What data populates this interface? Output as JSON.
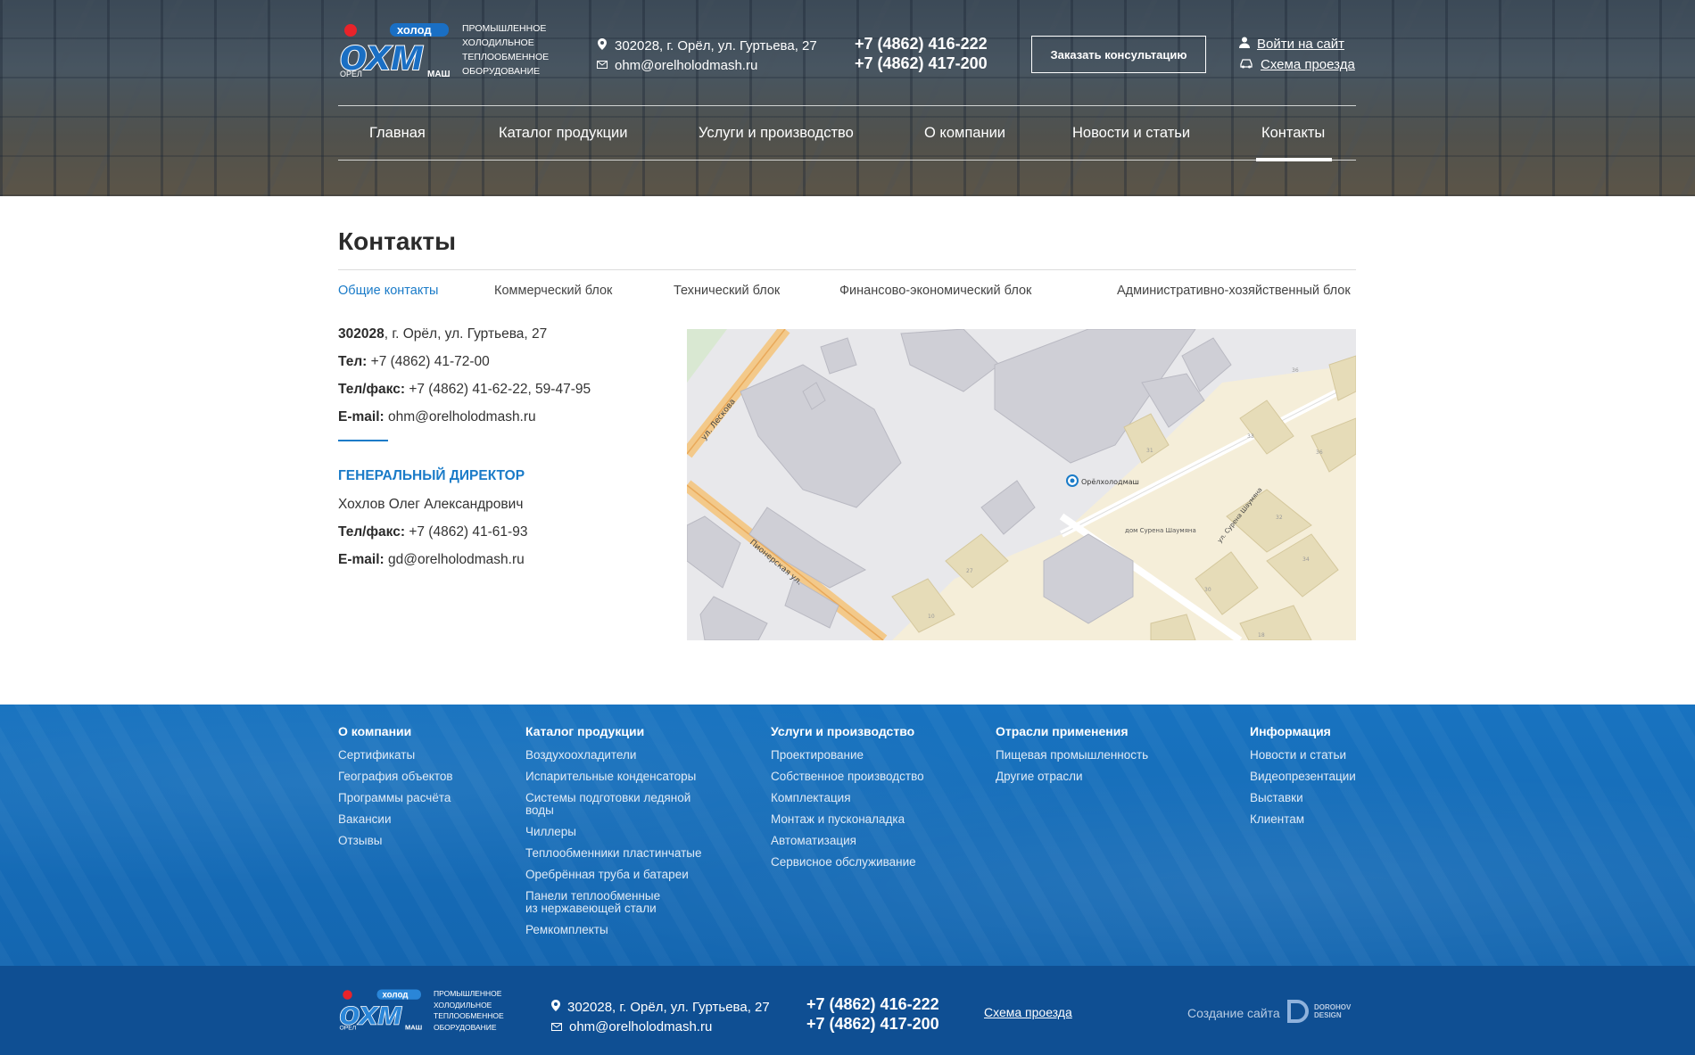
{
  "header": {
    "logo_tagline": [
      "Промышленное",
      "холодильное",
      "теплообменное",
      "оборудование"
    ],
    "address": "302028, г. Орёл, ул. Гуртьева, 27",
    "email": "ohm@orelholodmash.ru",
    "phone1": "+7 (4862) 416-222",
    "phone2": "+7 (4862) 417-200",
    "consult_button": "Заказать консультацию",
    "login_link": "Войти на сайт",
    "route_link": "Схема проезда"
  },
  "nav": [
    {
      "label": "Главная"
    },
    {
      "label": "Каталог продукции"
    },
    {
      "label": "Услуги и производство"
    },
    {
      "label": "О компании"
    },
    {
      "label": "Новости и статьи"
    },
    {
      "label": "Контакты",
      "active": true
    }
  ],
  "page": {
    "title": "Контакты",
    "tabs": [
      "Общие контакты",
      "Коммерческий блок",
      "Технический блок",
      "Финансово-экономический блок",
      "Административно-хозяйственный блок"
    ]
  },
  "contacts": {
    "postcode": "302028",
    "address_rest": ", г. Орёл, ул. Гуртьева, 27",
    "tel_label": "Тел:",
    "tel": "+7 (4862) 41-72-00",
    "telfax_label": "Тел/факс:",
    "telfax": "+7 (4862) 41-62-22, 59-47-95",
    "email_label": "E-mail:",
    "email": "ohm@orelholodmash.ru",
    "director_title": "Генеральный директор",
    "director_name": "Хохлов Олег Александрович",
    "director_telfax": "+7 (4862) 41-61-93",
    "director_email": "gd@orelholodmash.ru"
  },
  "map": {
    "street1": "ул. Лескова",
    "street2": "Пионерская ул.",
    "street3": "ул. Сурена Шаумяна",
    "marker": "Орёлхолодмаш",
    "poi": "дом Сурена Шаумяна",
    "numbers": [
      "36",
      "33",
      "31",
      "36",
      "32",
      "34",
      "30",
      "27",
      "10",
      "18"
    ]
  },
  "footer": {
    "columns": [
      {
        "title": "О компании",
        "links": [
          "Сертификаты",
          "География объектов",
          "Программы расчёта",
          "Вакансии",
          "Отзывы"
        ]
      },
      {
        "title": "Каталог продукции",
        "links": [
          "Воздухоохладители",
          "Испарительные конденсаторы",
          "Системы подготовки ледяной воды",
          "Чиллеры",
          "Теплообменники пластинчатые",
          "Оребрённая труба и батареи",
          "Панели теплообменные из нержавеющей стали",
          "Ремкомплекты"
        ]
      },
      {
        "title": "Услуги и производство",
        "links": [
          "Проектирование",
          "Собственное производство",
          "Комплектация",
          "Монтаж и пусконаладка",
          "Автоматизация",
          "Сервисное обслуживание"
        ]
      },
      {
        "title": "Отрасли применения",
        "links": [
          "Пищевая промышленность",
          "Другие отрасли"
        ]
      },
      {
        "title": "Информация",
        "links": [
          "Новости и статьи",
          "Видеопрезентации",
          "Выставки",
          "Клиентам"
        ]
      }
    ],
    "address": "302028, г. Орёл, ул. Гуртьева, 27",
    "email": "ohm@orelholodmash.ru",
    "phone1": "+7 (4862) 416-222",
    "phone2": "+7 (4862) 417-200",
    "route_link": "Схема проезда",
    "created_by": "Создание сайта",
    "developer": [
      "DOROHOV",
      "DESIGN"
    ]
  },
  "logo": {
    "top": "холод",
    "left": "орел",
    "right": "маш",
    "letters": "ОХМ"
  },
  "colors": {
    "accent": "#1a7bc8",
    "footer": "#1670bc",
    "bottom": "#0f4f93"
  }
}
